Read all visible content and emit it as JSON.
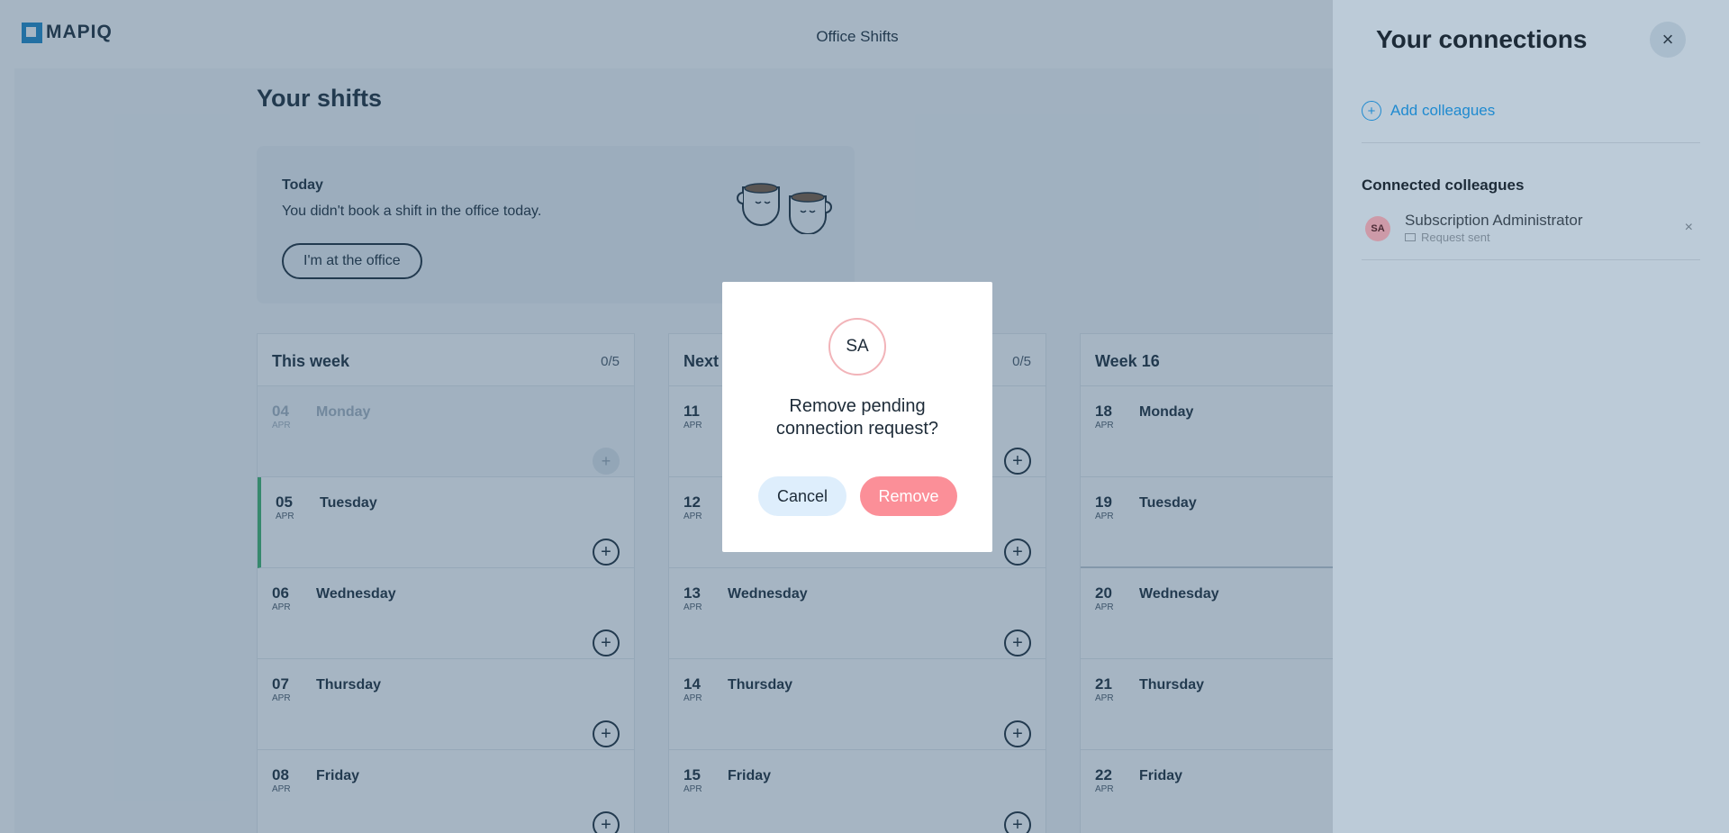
{
  "app": {
    "logo_text": "MAPIQ",
    "title": "Office Shifts"
  },
  "page": {
    "title": "Your shifts",
    "today": {
      "label": "Today",
      "message": "You didn't book a shift in the office today.",
      "button": "I'm at the office"
    }
  },
  "weeks": [
    {
      "name": "This week",
      "count": "0/5",
      "days": [
        {
          "num": "04",
          "month": "APR",
          "name": "Monday",
          "state": "past"
        },
        {
          "num": "05",
          "month": "APR",
          "name": "Tuesday",
          "state": "today"
        },
        {
          "num": "06",
          "month": "APR",
          "name": "Wednesday",
          "state": "normal"
        },
        {
          "num": "07",
          "month": "APR",
          "name": "Thursday",
          "state": "normal"
        },
        {
          "num": "08",
          "month": "APR",
          "name": "Friday",
          "state": "normal"
        }
      ]
    },
    {
      "name": "Next",
      "count": "0/5",
      "days": [
        {
          "num": "11",
          "month": "APR",
          "name": "",
          "state": "normal"
        },
        {
          "num": "12",
          "month": "APR",
          "name": "",
          "state": "normal"
        },
        {
          "num": "13",
          "month": "APR",
          "name": "Wednesday",
          "state": "normal"
        },
        {
          "num": "14",
          "month": "APR",
          "name": "Thursday",
          "state": "normal"
        },
        {
          "num": "15",
          "month": "APR",
          "name": "Friday",
          "state": "normal"
        }
      ]
    },
    {
      "name": "Week 16",
      "count": "",
      "days": [
        {
          "num": "18",
          "month": "APR",
          "name": "Monday",
          "state": "normal"
        },
        {
          "num": "19",
          "month": "APR",
          "name": "Tuesday",
          "state": "normal"
        },
        {
          "num": "20",
          "month": "APR",
          "name": "Wednesday",
          "state": "normal"
        },
        {
          "num": "21",
          "month": "APR",
          "name": "Thursday",
          "state": "normal"
        },
        {
          "num": "22",
          "month": "APR",
          "name": "Friday",
          "state": "normal"
        }
      ]
    }
  ],
  "panel": {
    "title": "Your connections",
    "close_icon": "×",
    "add_label": "Add colleagues",
    "section_label": "Connected colleagues",
    "colleague": {
      "initials": "SA",
      "name": "Subscription Administrator",
      "status": "Request sent",
      "remove_icon": "×"
    }
  },
  "modal": {
    "initials": "SA",
    "title_line1": "Remove pending",
    "title_line2": "connection request?",
    "cancel": "Cancel",
    "remove": "Remove"
  },
  "icons": {
    "plus": "+"
  },
  "colors": {
    "accent": "#1f8ad0",
    "today_marker": "#3fb36b",
    "remove_button": "#fb8f98",
    "cancel_button": "#deeefc"
  }
}
